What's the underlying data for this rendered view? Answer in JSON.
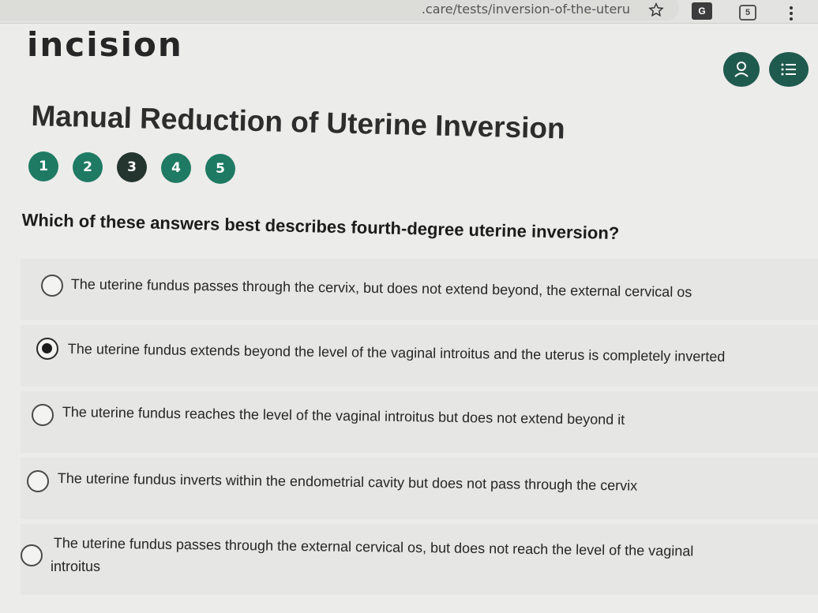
{
  "browser": {
    "url": ".care/tests/inversion-of-the-uteru",
    "tab_count": "5",
    "translate_label": "G"
  },
  "header": {
    "logo": "incision"
  },
  "page": {
    "title": "Manual Reduction of Uterine Inversion",
    "steps": [
      "1",
      "2",
      "3",
      "4",
      "5"
    ],
    "active_step": 3,
    "question": "Which of these answers best describes fourth-degree uterine inversion?"
  },
  "options": [
    {
      "text": "The uterine fundus passes through the cervix, but does not extend beyond, the external cervical os",
      "selected": false
    },
    {
      "text": "The uterine fundus extends beyond the level of the vaginal introitus and the uterus is completely inverted",
      "selected": true
    },
    {
      "text": "The uterine fundus reaches the level of the vaginal introitus but does not extend beyond it",
      "selected": false
    },
    {
      "text": "The uterine fundus inverts within the endometrial cavity but does not pass through the cervix",
      "selected": false
    },
    {
      "text": "The uterine fundus passes through the external cervical os, but does not reach the level of the vaginal",
      "text2": "introitus",
      "selected": false
    }
  ],
  "colors": {
    "accent": "#1e7a63",
    "active_step": "#24342f",
    "header_button": "#1f5a4e"
  }
}
